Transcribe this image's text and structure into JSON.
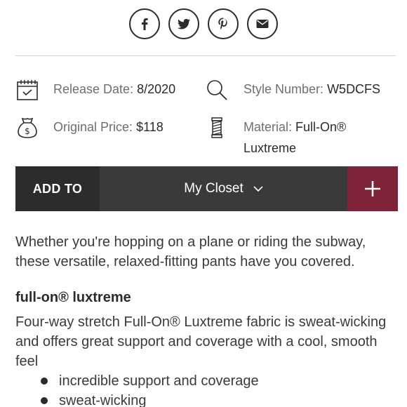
{
  "share": {
    "icons": [
      "facebook-icon",
      "twitter-icon",
      "pinterest-icon",
      "email-icon"
    ]
  },
  "meta": {
    "release_label": "Release Date:",
    "release_value": "8/2020",
    "style_label": "Style Number:",
    "style_value": "W5DCFS",
    "price_label": "Original Price:",
    "price_value": "$118",
    "material_label": "Material:",
    "material_value_line1": "Full-On®",
    "material_value_line2": "Luxtreme"
  },
  "closet": {
    "add_to_label": "ADD TO",
    "selected": "My Closet",
    "accent_color": "#7f2339"
  },
  "description": {
    "intro": "Whether you're hopping on a plane or riding the subway, these versatile, relaxed-fitting pants have you covered.",
    "section_title": "full-on® luxtreme",
    "section_text": "Four-way stretch Full-On® Luxtreme fabric is sweat-wicking and offers great support and coverage with a cool, smooth feel",
    "bullets": [
      "incredible support and coverage",
      "sweat-wicking"
    ]
  }
}
